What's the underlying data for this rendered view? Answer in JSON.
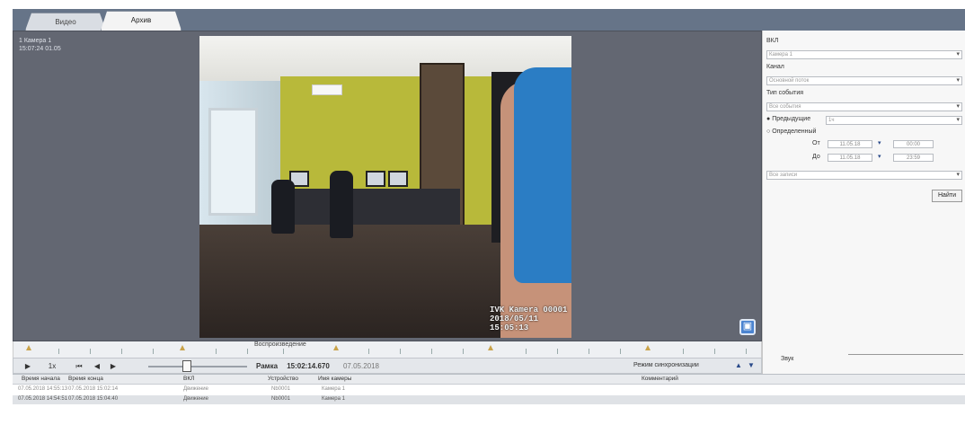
{
  "tabs": [
    {
      "label": "Видео",
      "active": false
    },
    {
      "label": "Архив",
      "active": true
    }
  ],
  "video": {
    "camera_label_line1": "1 Камера 1",
    "camera_label_line2": "15:07:24 01.05",
    "osd_line1": "IVK Kamera 00001",
    "osd_line2": "2018/05/11 15:05:13",
    "corner_icon": "save-frame-icon"
  },
  "timeline": {
    "label": "Воспроизведение"
  },
  "controls": {
    "play_icon": "play-icon",
    "speed": "1x",
    "frame_label": "Рамка",
    "time_value": "15:02:14.670",
    "date_value": "07.05.2018",
    "mode_label": "Режим синхронизации"
  },
  "side": {
    "label1": "ВКЛ",
    "combo1": "Камера 1",
    "label2": "Канал",
    "combo2": "Основной поток",
    "label3": "Тип события",
    "combo3": "Все события",
    "radio1": "Предыдущие",
    "radio1_value": "1ч",
    "radio2": "Определенный",
    "from_label": "От",
    "to_label": "До",
    "from_date": "11.05.18",
    "from_time": "00:00",
    "to_date": "11.05.18",
    "to_time": "23:59",
    "combo4": "Все записи",
    "find_label": "Найти",
    "volume_label": "Звук"
  },
  "table": {
    "headers": [
      "Время начала",
      "Время конца",
      "ВКЛ",
      "Устройство",
      "Имя камеры",
      "Комментарий"
    ],
    "rows": [
      {
        "start": "07.05.2018 14:55:13",
        "end": "07.05.2018 15:02:14",
        "vkl": "Движение",
        "device": "Nb0001",
        "camera": "Камера 1",
        "comment": "",
        "selected": false
      },
      {
        "start": "07.05.2018 14:54:51",
        "end": "07.05.2018 15:04:40",
        "vkl": "Движение",
        "device": "Nb0001",
        "camera": "Камера 1",
        "comment": "",
        "selected": true
      }
    ]
  },
  "colors": {
    "tab_band": "#667488",
    "video_bg": "#636772",
    "accent": "#4b84d0"
  }
}
